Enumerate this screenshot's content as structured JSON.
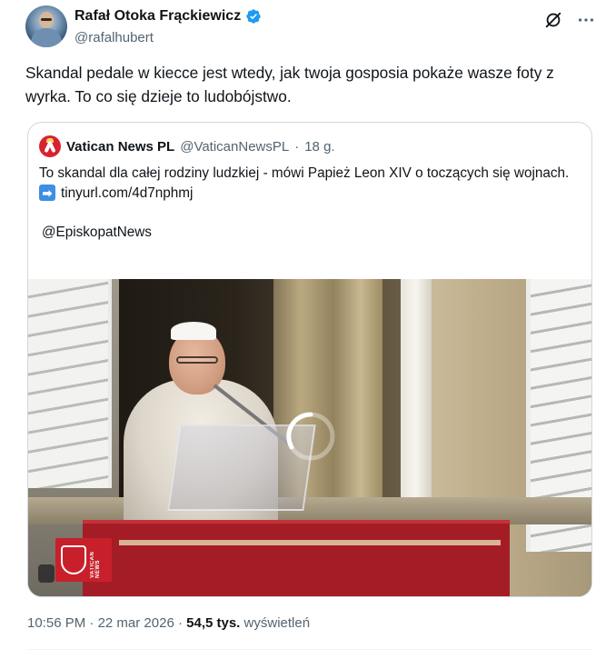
{
  "author": {
    "name": "Rafał Otoka Frąckiewicz",
    "handle": "@rafalhubert"
  },
  "icons": {
    "verified": "verified-badge-icon",
    "grok": "grok-icon",
    "more": "more-options-icon"
  },
  "tweet": {
    "text": "Skandal pedale w kiecce jest wtedy, jak twoja gosposia pokaże wasze foty z wyrka. To co się dzieje to ludobójstwo."
  },
  "quote": {
    "name": "Vatican News PL",
    "handle": "@VaticanNewsPL",
    "separator": "·",
    "age": "18 g.",
    "text_line": "To skandal dla całej rodziny ludzkiej - mówi Papież Leon XIV o toczących się wojnach.",
    "link_icon": "➡",
    "link": "tinyurl.com/4d7nphmj",
    "mention": "@EpiskopatNews",
    "video_logo_text": "VATICAN NEWS"
  },
  "footer": {
    "time": "10:56 PM",
    "separator": "·",
    "date": "22 mar 2026",
    "separator2": "·",
    "views_count": "54,5 tys.",
    "views_label": "wyświetleń"
  },
  "colors": {
    "verified_blue": "#1d9bf0",
    "text_primary": "#0f1419",
    "text_secondary": "#536471",
    "border": "#cfd9de"
  }
}
